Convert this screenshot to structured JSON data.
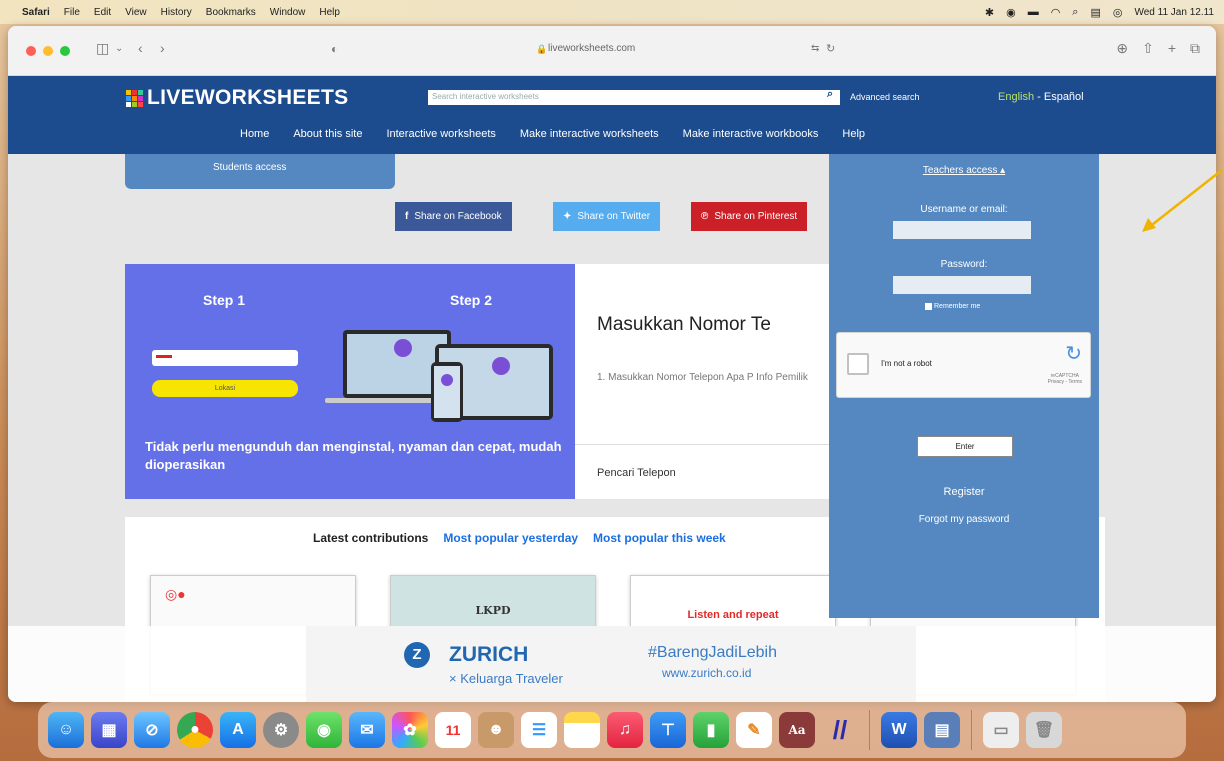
{
  "menubar": {
    "app": "Safari",
    "items": [
      "File",
      "Edit",
      "View",
      "History",
      "Bookmarks",
      "Window",
      "Help"
    ],
    "clock": "Wed 11 Jan  12.11"
  },
  "safari": {
    "url": "liveworksheets.com"
  },
  "site": {
    "logo": "LIVEWORKSHEETS",
    "search_placeholder": "Search interactive worksheets",
    "advanced_search": "Advanced search",
    "lang_en": "English",
    "lang_sep": " - ",
    "lang_es": "Español",
    "nav": [
      "Home",
      "About this site",
      "Interactive worksheets",
      "Make interactive worksheets",
      "Make interactive workbooks",
      "Help"
    ],
    "students_access": "Students access",
    "share": {
      "facebook": "Share on Facebook",
      "twitter": "Share on Twitter",
      "pinterest": "Share on Pinterest"
    }
  },
  "banner": {
    "step1": "Step 1",
    "step2": "Step 2",
    "button": "Lokasi",
    "text": "Tidak perlu mengunduh dan menginstal, nyaman dan cepat, mudah dioperasikan"
  },
  "card": {
    "title": "Masukkan Nomor Te",
    "desc": "1. Masukkan Nomor Telepon Apa P Info Pemilik",
    "sub": "Pencari Telepon"
  },
  "latest": {
    "tab_latest": "Latest contributions",
    "tab_yesterday": "Most popular yesterday",
    "tab_week": "Most popular this week",
    "thumb2": "LKPD",
    "thumb3": "Listen and repeat"
  },
  "teachers": {
    "toggle": "Teachers access ▴",
    "username_label": "Username or email:",
    "password_label": "Password:",
    "remember": "Remember me",
    "captcha": "I'm not a robot",
    "captcha_brand": "reCAPTCHA",
    "captcha_links": "Privacy - Terms",
    "enter": "Enter",
    "register": "Register",
    "forgot": "Forgot my password"
  },
  "ad": {
    "brand": "ZURICH",
    "tagline": "× Keluarga Traveler",
    "hashtag": "#BarengJadiLebih",
    "url": "www.zurich.co.id"
  },
  "colors": {
    "header": "#1c4c8e",
    "panel": "#5588c0",
    "banner": "#6470e8",
    "link": "#1b6fe0"
  }
}
